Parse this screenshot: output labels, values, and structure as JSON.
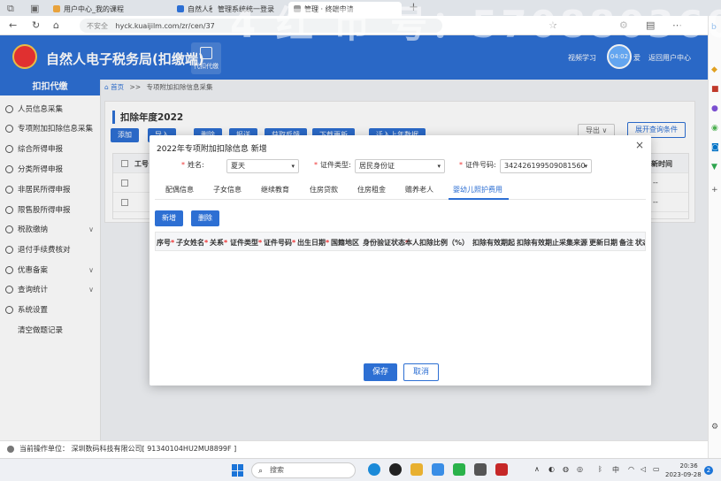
{
  "browser": {
    "tabs": [
      {
        "label": "用户中心_我的课程"
      },
      {
        "label": "自然人税"
      },
      {
        "label": "管理系统统一登录"
      },
      {
        "label": "管理 · 终端申请"
      }
    ],
    "new_tab": "+",
    "security_label": "不安全",
    "url": "hyck.kuaijilm.com/zr/cen/37"
  },
  "watermark": "4 红 币 号：570880360",
  "header": {
    "app_title": "自然人电子税务局(扣缴端)",
    "module_label": "代扣代缴",
    "video_link": "视频学习",
    "timer_text": "04:02",
    "timer_suffix": "爱",
    "return_link": "返回用户中心"
  },
  "sidebar": {
    "head": "扣扣代缴",
    "items": [
      {
        "label": "人员信息采集",
        "icon": "person-icon"
      },
      {
        "label": "专项附加扣除信息采集",
        "icon": "person-icon"
      },
      {
        "label": "综合所得申报",
        "icon": "doc-icon"
      },
      {
        "label": "分类所得申报",
        "icon": "doc-icon"
      },
      {
        "label": "非居民所得申报",
        "icon": "person-icon"
      },
      {
        "label": "限售股所得申报",
        "icon": "card-icon"
      },
      {
        "label": "税款缴纳",
        "icon": "doc-icon",
        "expand": "∨"
      },
      {
        "label": "退付手续费核对",
        "icon": "doc-icon"
      },
      {
        "label": "优惠备案",
        "icon": "doc-icon",
        "expand": "∨"
      },
      {
        "label": "查询统计",
        "icon": "doc-icon",
        "expand": "∨"
      },
      {
        "label": "系统设置",
        "icon": "gear-icon"
      },
      {
        "label": "清空做题记录",
        "icon": ""
      }
    ]
  },
  "breadcrumb": {
    "home": "首页",
    "sep": ">>",
    "current": "专项附加扣除信息采集"
  },
  "panel": {
    "title": "扣除年度2022",
    "toolbar": [
      "添加",
      "导入",
      "删除",
      "报送",
      "获取反馈",
      "下载更新",
      "迁入上年数据"
    ],
    "export_label": "导出",
    "expand_query": "展开查询条件",
    "table": {
      "col_staff_no": "工号",
      "col_update_status": "更新时间",
      "dash": "--"
    }
  },
  "modal": {
    "title": "2022年专项附加扣除信息 新增",
    "close": "×",
    "name_label": "姓名:",
    "name_value": "夏天",
    "id_type_label": "证件类型:",
    "id_type_value": "居民身份证",
    "id_no_label": "证件号码:",
    "id_no_value": "342426199509081560",
    "tabs": [
      "配偶信息",
      "子女信息",
      "继续教育",
      "住房贷款",
      "住房租金",
      "赡养老人",
      "婴幼儿照护费用"
    ],
    "active_tab": "婴幼儿照护费用",
    "add_btn": "新增",
    "delete_btn": "删除",
    "columns": [
      {
        "label": "序号",
        "req": true
      },
      {
        "label": "子女姓名",
        "req": true
      },
      {
        "label": "关系",
        "req": true
      },
      {
        "label": "证件类型",
        "req": true
      },
      {
        "label": "证件号码",
        "req": true
      },
      {
        "label": "出生日期",
        "req": true
      },
      {
        "label": "国籍地区",
        "req": false
      },
      {
        "label": "身份验证状态",
        "req": true
      },
      {
        "label": "本人扣除比例（%）",
        "req": false
      },
      {
        "label": "扣除有效期起",
        "req": false
      },
      {
        "label": "扣除有效期止",
        "req": false
      },
      {
        "label": "采集来源",
        "req": false
      },
      {
        "label": "更新日期",
        "req": false
      },
      {
        "label": "备注",
        "req": false
      },
      {
        "label": "状态",
        "req": false
      }
    ],
    "save_btn": "保存",
    "cancel_btn": "取消"
  },
  "statusbar": {
    "label": "当前操作单位：",
    "unit": "深圳数码科技有限公司[ 91340104HU2MU8899F ]"
  },
  "taskbar": {
    "search_placeholder": "搜索",
    "tray_ime": "中",
    "time": "20:36",
    "date": "2023-09-28",
    "notif_count": "2"
  },
  "colors": {
    "primary": "#2d6fd3",
    "required": "#e33333"
  }
}
